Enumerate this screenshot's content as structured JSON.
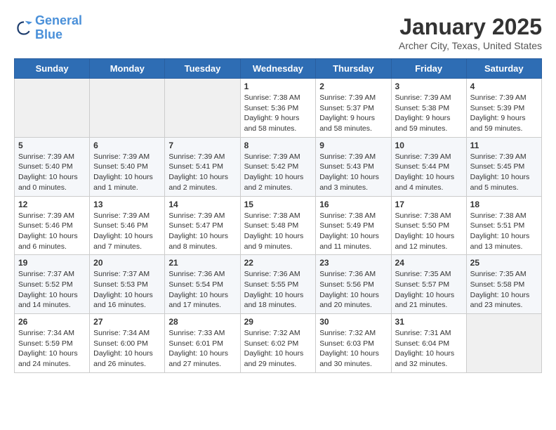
{
  "header": {
    "logo_line1": "General",
    "logo_line2": "Blue",
    "title": "January 2025",
    "subtitle": "Archer City, Texas, United States"
  },
  "days_of_week": [
    "Sunday",
    "Monday",
    "Tuesday",
    "Wednesday",
    "Thursday",
    "Friday",
    "Saturday"
  ],
  "weeks": [
    [
      {
        "day": "",
        "info": ""
      },
      {
        "day": "",
        "info": ""
      },
      {
        "day": "",
        "info": ""
      },
      {
        "day": "1",
        "info": "Sunrise: 7:38 AM\nSunset: 5:36 PM\nDaylight: 9 hours and 58 minutes."
      },
      {
        "day": "2",
        "info": "Sunrise: 7:39 AM\nSunset: 5:37 PM\nDaylight: 9 hours and 58 minutes."
      },
      {
        "day": "3",
        "info": "Sunrise: 7:39 AM\nSunset: 5:38 PM\nDaylight: 9 hours and 59 minutes."
      },
      {
        "day": "4",
        "info": "Sunrise: 7:39 AM\nSunset: 5:39 PM\nDaylight: 9 hours and 59 minutes."
      }
    ],
    [
      {
        "day": "5",
        "info": "Sunrise: 7:39 AM\nSunset: 5:40 PM\nDaylight: 10 hours and 0 minutes."
      },
      {
        "day": "6",
        "info": "Sunrise: 7:39 AM\nSunset: 5:40 PM\nDaylight: 10 hours and 1 minute."
      },
      {
        "day": "7",
        "info": "Sunrise: 7:39 AM\nSunset: 5:41 PM\nDaylight: 10 hours and 2 minutes."
      },
      {
        "day": "8",
        "info": "Sunrise: 7:39 AM\nSunset: 5:42 PM\nDaylight: 10 hours and 2 minutes."
      },
      {
        "day": "9",
        "info": "Sunrise: 7:39 AM\nSunset: 5:43 PM\nDaylight: 10 hours and 3 minutes."
      },
      {
        "day": "10",
        "info": "Sunrise: 7:39 AM\nSunset: 5:44 PM\nDaylight: 10 hours and 4 minutes."
      },
      {
        "day": "11",
        "info": "Sunrise: 7:39 AM\nSunset: 5:45 PM\nDaylight: 10 hours and 5 minutes."
      }
    ],
    [
      {
        "day": "12",
        "info": "Sunrise: 7:39 AM\nSunset: 5:46 PM\nDaylight: 10 hours and 6 minutes."
      },
      {
        "day": "13",
        "info": "Sunrise: 7:39 AM\nSunset: 5:46 PM\nDaylight: 10 hours and 7 minutes."
      },
      {
        "day": "14",
        "info": "Sunrise: 7:39 AM\nSunset: 5:47 PM\nDaylight: 10 hours and 8 minutes."
      },
      {
        "day": "15",
        "info": "Sunrise: 7:38 AM\nSunset: 5:48 PM\nDaylight: 10 hours and 9 minutes."
      },
      {
        "day": "16",
        "info": "Sunrise: 7:38 AM\nSunset: 5:49 PM\nDaylight: 10 hours and 11 minutes."
      },
      {
        "day": "17",
        "info": "Sunrise: 7:38 AM\nSunset: 5:50 PM\nDaylight: 10 hours and 12 minutes."
      },
      {
        "day": "18",
        "info": "Sunrise: 7:38 AM\nSunset: 5:51 PM\nDaylight: 10 hours and 13 minutes."
      }
    ],
    [
      {
        "day": "19",
        "info": "Sunrise: 7:37 AM\nSunset: 5:52 PM\nDaylight: 10 hours and 14 minutes."
      },
      {
        "day": "20",
        "info": "Sunrise: 7:37 AM\nSunset: 5:53 PM\nDaylight: 10 hours and 16 minutes."
      },
      {
        "day": "21",
        "info": "Sunrise: 7:36 AM\nSunset: 5:54 PM\nDaylight: 10 hours and 17 minutes."
      },
      {
        "day": "22",
        "info": "Sunrise: 7:36 AM\nSunset: 5:55 PM\nDaylight: 10 hours and 18 minutes."
      },
      {
        "day": "23",
        "info": "Sunrise: 7:36 AM\nSunset: 5:56 PM\nDaylight: 10 hours and 20 minutes."
      },
      {
        "day": "24",
        "info": "Sunrise: 7:35 AM\nSunset: 5:57 PM\nDaylight: 10 hours and 21 minutes."
      },
      {
        "day": "25",
        "info": "Sunrise: 7:35 AM\nSunset: 5:58 PM\nDaylight: 10 hours and 23 minutes."
      }
    ],
    [
      {
        "day": "26",
        "info": "Sunrise: 7:34 AM\nSunset: 5:59 PM\nDaylight: 10 hours and 24 minutes."
      },
      {
        "day": "27",
        "info": "Sunrise: 7:34 AM\nSunset: 6:00 PM\nDaylight: 10 hours and 26 minutes."
      },
      {
        "day": "28",
        "info": "Sunrise: 7:33 AM\nSunset: 6:01 PM\nDaylight: 10 hours and 27 minutes."
      },
      {
        "day": "29",
        "info": "Sunrise: 7:32 AM\nSunset: 6:02 PM\nDaylight: 10 hours and 29 minutes."
      },
      {
        "day": "30",
        "info": "Sunrise: 7:32 AM\nSunset: 6:03 PM\nDaylight: 10 hours and 30 minutes."
      },
      {
        "day": "31",
        "info": "Sunrise: 7:31 AM\nSunset: 6:04 PM\nDaylight: 10 hours and 32 minutes."
      },
      {
        "day": "",
        "info": ""
      }
    ]
  ]
}
